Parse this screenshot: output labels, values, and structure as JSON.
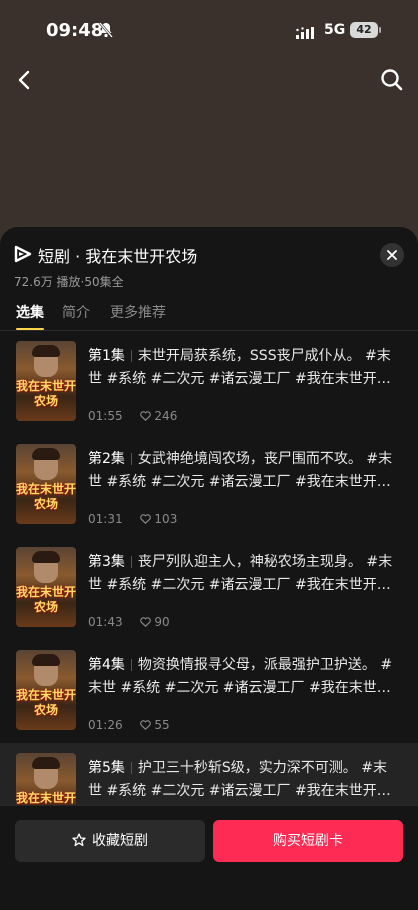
{
  "status_bar": {
    "time": "09:48",
    "network": "5G",
    "battery": "42"
  },
  "sheet": {
    "title": "短剧 · 我在末世开农场",
    "subtitle": "72.6万 播放·50集全",
    "tabs": [
      {
        "label": "选集",
        "active": true
      },
      {
        "label": "简介",
        "active": false
      },
      {
        "label": "更多推荐",
        "active": false
      }
    ]
  },
  "thumb_title": "我在末世开农场",
  "episodes": [
    {
      "number": "第1集",
      "text": "末世开局获系统，SSS丧尸成仆从。 #末世 #系统 #二次元 #诸云漫工厂 #我在末世开农场",
      "duration": "01:55",
      "likes": "246"
    },
    {
      "number": "第2集",
      "text": "女武神绝境闯农场，丧尸围而不攻。 #末世 #系统 #二次元 #诸云漫工厂 #我在末世开农场",
      "duration": "01:31",
      "likes": "103"
    },
    {
      "number": "第3集",
      "text": "丧尸列队迎主人，神秘农场主现身。 #末世 #系统 #二次元 #诸云漫工厂 #我在末世开农场",
      "duration": "01:43",
      "likes": "90"
    },
    {
      "number": "第4集",
      "text": "物资换情报寻父母，派最强护卫护送。 #末世 #系统 #二次元 #诸云漫工厂 #我在末世开农场",
      "duration": "01:26",
      "likes": "55"
    },
    {
      "number": "第5集",
      "text": "护卫三十秒斩S级，实力深不可测。 #末世 #系统 #二次元 #诸云漫工厂 #我在末世开农场",
      "duration": "",
      "likes": ""
    }
  ],
  "bottom": {
    "favorite_label": "收藏短剧",
    "buy_label": "购买短剧卡"
  },
  "colors": {
    "accent": "#fe2c55",
    "tab_indicator": "#ffd54a",
    "sheet_bg": "#151515"
  }
}
